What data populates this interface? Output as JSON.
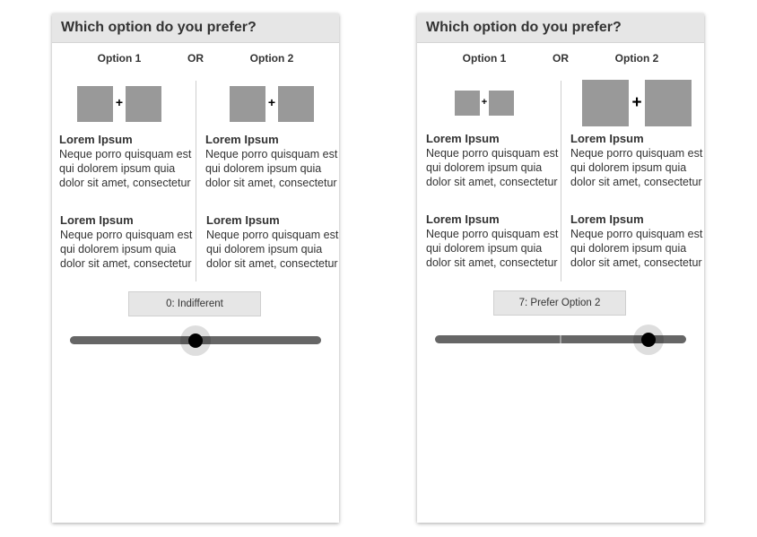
{
  "cards": [
    {
      "title": "Which option do you prefer?",
      "option1_label": "Option 1",
      "or_label": "OR",
      "option2_label": "Option 2",
      "option1_items": [
        {
          "title": "Lorem Ipsum",
          "body": "Neque porro quisquam est qui dolorem ipsum quia dolor sit amet, consectetur"
        },
        {
          "title": "Lorem Ipsum",
          "body": "Neque porro quisquam est qui dolorem ipsum quia dolor sit amet, consectetur"
        }
      ],
      "option2_items": [
        {
          "title": "Lorem Ipsum",
          "body": "Neque porro quisquam est qui dolorem ipsum quia dolor sit amet, consectetur"
        },
        {
          "title": "Lorem Ipsum",
          "body": "Neque porro quisquam est qui dolorem ipsum quia dolor sit amet, consectetur"
        }
      ],
      "plus_symbol": "+",
      "value_text": "0: Indifferent",
      "slider": {
        "min": -10,
        "max": 10,
        "value": 0
      }
    },
    {
      "title": "Which option do you prefer?",
      "option1_label": "Option 1",
      "or_label": "OR",
      "option2_label": "Option 2",
      "option1_items": [
        {
          "title": "Lorem Ipsum",
          "body": "Neque porro quisquam est qui dolorem ipsum quia dolor sit amet, consectetur"
        },
        {
          "title": "Lorem Ipsum",
          "body": "Neque porro quisquam est qui dolorem ipsum quia dolor sit amet, consectetur"
        }
      ],
      "option2_items": [
        {
          "title": "Lorem Ipsum",
          "body": "Neque porro quisquam est qui dolorem ipsum quia dolor sit amet, consectetur"
        },
        {
          "title": "Lorem Ipsum",
          "body": "Neque porro quisquam est qui dolorem ipsum quia dolor sit amet, consectetur"
        }
      ],
      "plus_symbol": "+",
      "value_text": "7: Prefer Option 2",
      "slider": {
        "min": -10,
        "max": 10,
        "value": 7
      }
    }
  ],
  "colors": {
    "header_bg": "#e6e6e6",
    "square": "#999999",
    "track": "#666666",
    "knob": "#000000"
  }
}
